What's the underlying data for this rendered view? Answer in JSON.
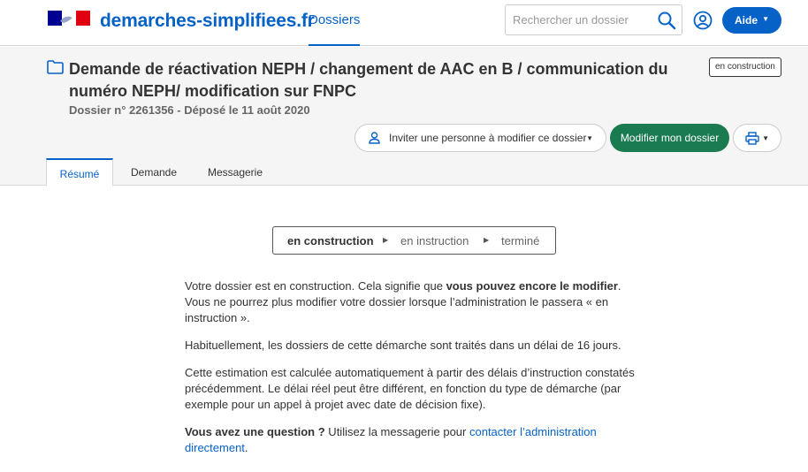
{
  "header": {
    "brand": "demarches-simplifiees.fr",
    "nav_dossiers": "Dossiers",
    "search_placeholder": "Rechercher un dossier",
    "aide_label": "Aide",
    "accent_color": "#0762c8"
  },
  "dossier": {
    "title": "Demande de réactivation NEPH / changement de AAC en B / communication du numéro NEPH/ modification sur FNPC",
    "subtitle": "Dossier n° 2261356 - Déposé le 11 août 2020",
    "status_badge": "en construction",
    "invite_label": "Inviter une personne à modifier ce dossier",
    "modify_label": "Modifier mon dossier",
    "modify_color": "#1a7a50"
  },
  "tabs": [
    {
      "label": "Résumé",
      "active": true
    },
    {
      "label": "Demande",
      "active": false
    },
    {
      "label": "Messagerie",
      "active": false
    }
  ],
  "progress": {
    "steps": [
      "en construction",
      "en instruction",
      "terminé"
    ],
    "current": "en construction"
  },
  "content": {
    "p1_before": "Votre dossier est en construction. Cela signifie que ",
    "p1_bold": "vous pouvez encore le modifier",
    "p1_after": ". Vous ne pourrez plus modifier votre dossier lorsque l’administration le passera « en instruction ».",
    "p2": "Habituellement, les dossiers de cette démarche sont traités dans un délai de 16 jours.",
    "p3": "Cette estimation est calculée automatiquement à partir des délais d’instruction constatés précédemment. Le délai réel peut être différent, en fonction du type de démarche (par exemple pour un appel à projet avec date de décision fixe).",
    "p4_bold": "Vous avez une question ?",
    "p4_text": " Utilisez la messagerie pour ",
    "p4_link": "contacter l’administration directement",
    "p4_end": "."
  }
}
